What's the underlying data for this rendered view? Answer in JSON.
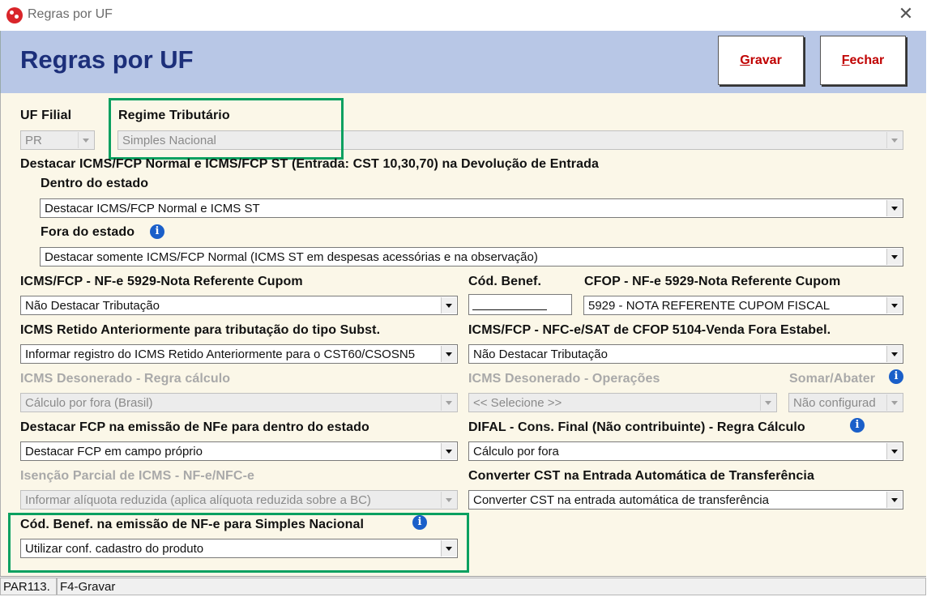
{
  "window": {
    "title": "Regras por UF"
  },
  "header": {
    "title": "Regras por UF",
    "save_hotkey": "G",
    "save_rest": "ravar",
    "close_hotkey": "F",
    "close_rest": "echar"
  },
  "fields": {
    "uf_filial": {
      "label": "UF Filial",
      "value": "PR"
    },
    "regime": {
      "label": "Regime Tributário",
      "value": "Simples Nacional"
    },
    "destacar_section": "Destacar ICMS/FCP Normal e ICMS/FCP ST (Entrada: CST 10,30,70) na Devolução de Entrada",
    "dentro_estado": {
      "label": "Dentro do estado",
      "value": "Destacar ICMS/FCP Normal e ICMS ST"
    },
    "fora_estado": {
      "label": "Fora do estado",
      "value": "Destacar somente ICMS/FCP Normal (ICMS ST em despesas acessórias e na observação)"
    },
    "icms_5929": {
      "label": "ICMS/FCP - NF-e 5929-Nota Referente Cupom",
      "value": "Não Destacar Tributação"
    },
    "cod_benef": {
      "label": "Cód. Benef.",
      "value": ""
    },
    "cfop_5929": {
      "label": "CFOP - NF-e 5929-Nota Referente Cupom",
      "value": "5929 - NOTA REFERENTE CUPOM FISCAL"
    },
    "icms_retido": {
      "label": "ICMS Retido Anteriormente para tributação do tipo Subst.",
      "value": "Informar registro do ICMS Retido Anteriormente para o CST60/CSOSN5"
    },
    "icms_5104": {
      "label": "ICMS/FCP - NFC-e/SAT de CFOP 5104-Venda Fora Estabel.",
      "value": "Não Destacar Tributação"
    },
    "deson_regra": {
      "label": "ICMS Desonerado - Regra cálculo",
      "value": "Cálculo por fora (Brasil)"
    },
    "deson_oper": {
      "label": "ICMS Desonerado - Operações",
      "value": "<< Selecione >>"
    },
    "somar_abater": {
      "label": "Somar/Abater",
      "value": "Não configurad"
    },
    "fcp_dentro": {
      "label": "Destacar FCP na emissão de NFe para dentro do estado",
      "value": "Destacar FCP em campo próprio"
    },
    "difal": {
      "label": "DIFAL - Cons. Final (Não contribuinte) - Regra Cálculo",
      "value": "Cálculo por fora"
    },
    "isencao": {
      "label": "Isenção Parcial de ICMS - NF-e/NFC-e",
      "value": "Informar alíquota reduzida (aplica alíquota reduzida sobre a BC)"
    },
    "converter_cst": {
      "label": "Converter CST na Entrada Automática de Transferência",
      "value": "Converter CST na entrada automática de transferência"
    },
    "cod_benef_sn": {
      "label": "Cód. Benef. na emissão de NF-e para Simples Nacional",
      "value": "Utilizar conf. cadastro do produto"
    }
  },
  "statusbar": {
    "code": "PAR113.",
    "hint": "F4-Gravar"
  },
  "colors": {
    "header_bg": "#b8c7e6",
    "title": "#1c2f7a",
    "button_text": "#c00000",
    "highlight": "#0aa060",
    "content_bg": "#fbf7e8"
  }
}
